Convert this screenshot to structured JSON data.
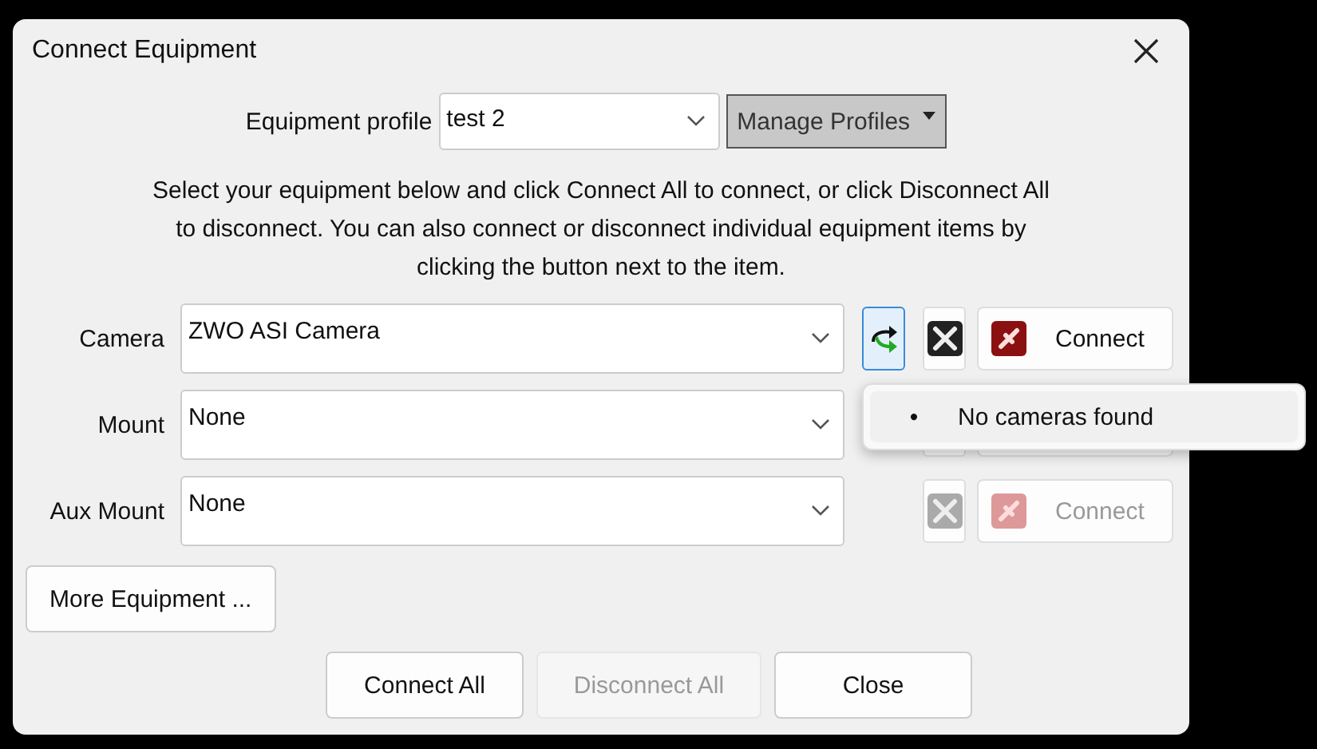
{
  "window": {
    "title": "Connect Equipment"
  },
  "profile": {
    "label": "Equipment profile",
    "value": "test 2",
    "manage_button": "Manage Profiles"
  },
  "instructions": "Select your equipment below and click Connect All to connect, or click Disconnect All to disconnect. You can also connect or disconnect individual equipment items by clicking the button next to the item.",
  "devices": [
    {
      "label": "Camera",
      "value": "ZWO ASI Camera",
      "refresh": true,
      "disabled": false,
      "connect_label": "Connect"
    },
    {
      "label": "Mount",
      "value": "None",
      "refresh": false
    },
    {
      "label": "Aux Mount",
      "value": "None",
      "refresh": false,
      "disabled": true,
      "connect_label": "Connect"
    }
  ],
  "popup_menu": {
    "items": [
      {
        "label": "No cameras found",
        "bullet": "•"
      }
    ]
  },
  "more_button": "More Equipment ...",
  "buttons": [
    {
      "label": "Connect All",
      "disabled": false
    },
    {
      "label": "Disconnect All",
      "disabled": true
    },
    {
      "label": "Close",
      "disabled": false
    }
  ]
}
